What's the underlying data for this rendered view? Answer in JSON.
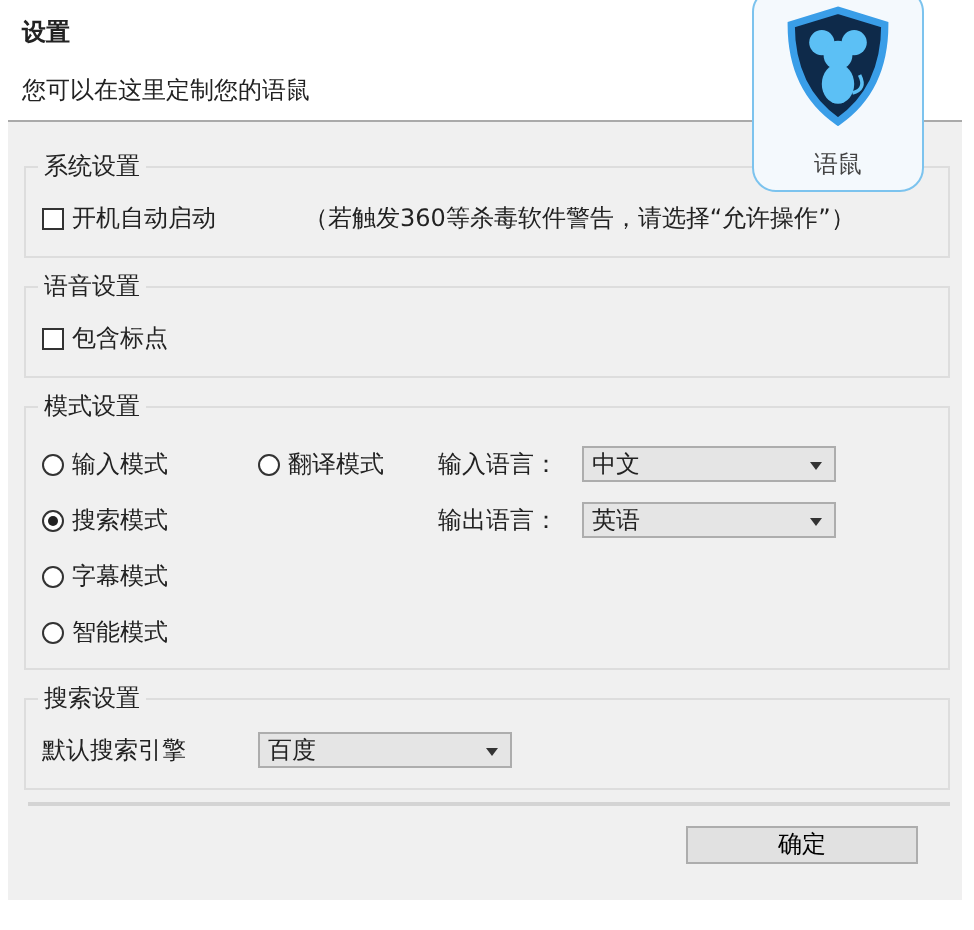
{
  "dialog": {
    "title": "设置",
    "subtitle": "您可以在这里定制您的语鼠",
    "logo_label": "语鼠"
  },
  "system": {
    "title": "系统设置",
    "autostart": {
      "label": "开机自动启动",
      "checked": false
    },
    "note": "（若触发360等杀毒软件警告，请选择“允许操作”）"
  },
  "voice": {
    "title": "语音设置",
    "punctuation": {
      "label": "包含标点",
      "checked": false
    }
  },
  "mode": {
    "title": "模式设置",
    "mode_columns": [
      [
        {
          "label": "输入模式",
          "selected": false
        },
        {
          "label": "搜索模式",
          "selected": true
        },
        {
          "label": "字幕模式",
          "selected": false
        },
        {
          "label": "智能模式",
          "selected": false
        }
      ],
      [
        {
          "label": "翻译模式",
          "selected": false
        }
      ]
    ],
    "languages": [
      {
        "label": "输入语言：",
        "value": "中文"
      },
      {
        "label": "输出语言：",
        "value": "英语"
      }
    ]
  },
  "search": {
    "title": "搜索设置",
    "engine": {
      "label": "默认搜索引擎",
      "value": "百度"
    }
  },
  "buttons": [
    "确定"
  ]
}
